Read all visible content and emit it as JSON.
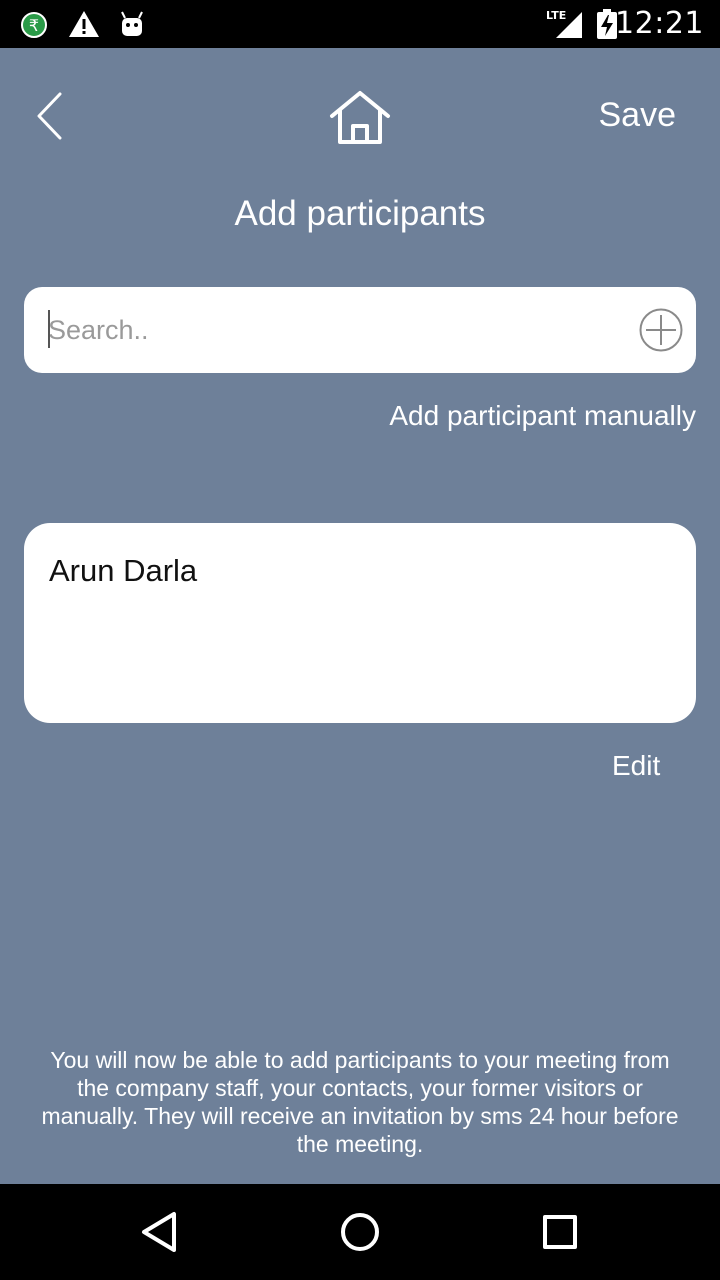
{
  "status_bar": {
    "time": "12:21",
    "network": "LTE",
    "icons": [
      "rupee-notification-icon",
      "warning-icon",
      "android-icon",
      "lte-signal-icon",
      "battery-charging-icon"
    ]
  },
  "app_bar": {
    "back_icon": "chevron-left-icon",
    "home_icon": "home-icon",
    "save_label": "Save"
  },
  "page": {
    "title": "Add participants"
  },
  "search": {
    "placeholder": "Search..",
    "value": "",
    "add_icon": "plus-circle-icon"
  },
  "add_manually_label": "Add participant manually",
  "participants": [
    {
      "name": "Arun Darla"
    }
  ],
  "edit_label": "Edit",
  "info_text": "You will now be able to add participants to your meeting from the company staff, your contacts, your former visitors or manually. They will receive an invitation by sms 24 hour before the meeting.",
  "nav_bar": {
    "icons": [
      "back-triangle-icon",
      "home-circle-icon",
      "recents-square-icon"
    ]
  },
  "colors": {
    "background": "#6e8099",
    "card": "#ffffff",
    "system_bar": "#000000"
  }
}
